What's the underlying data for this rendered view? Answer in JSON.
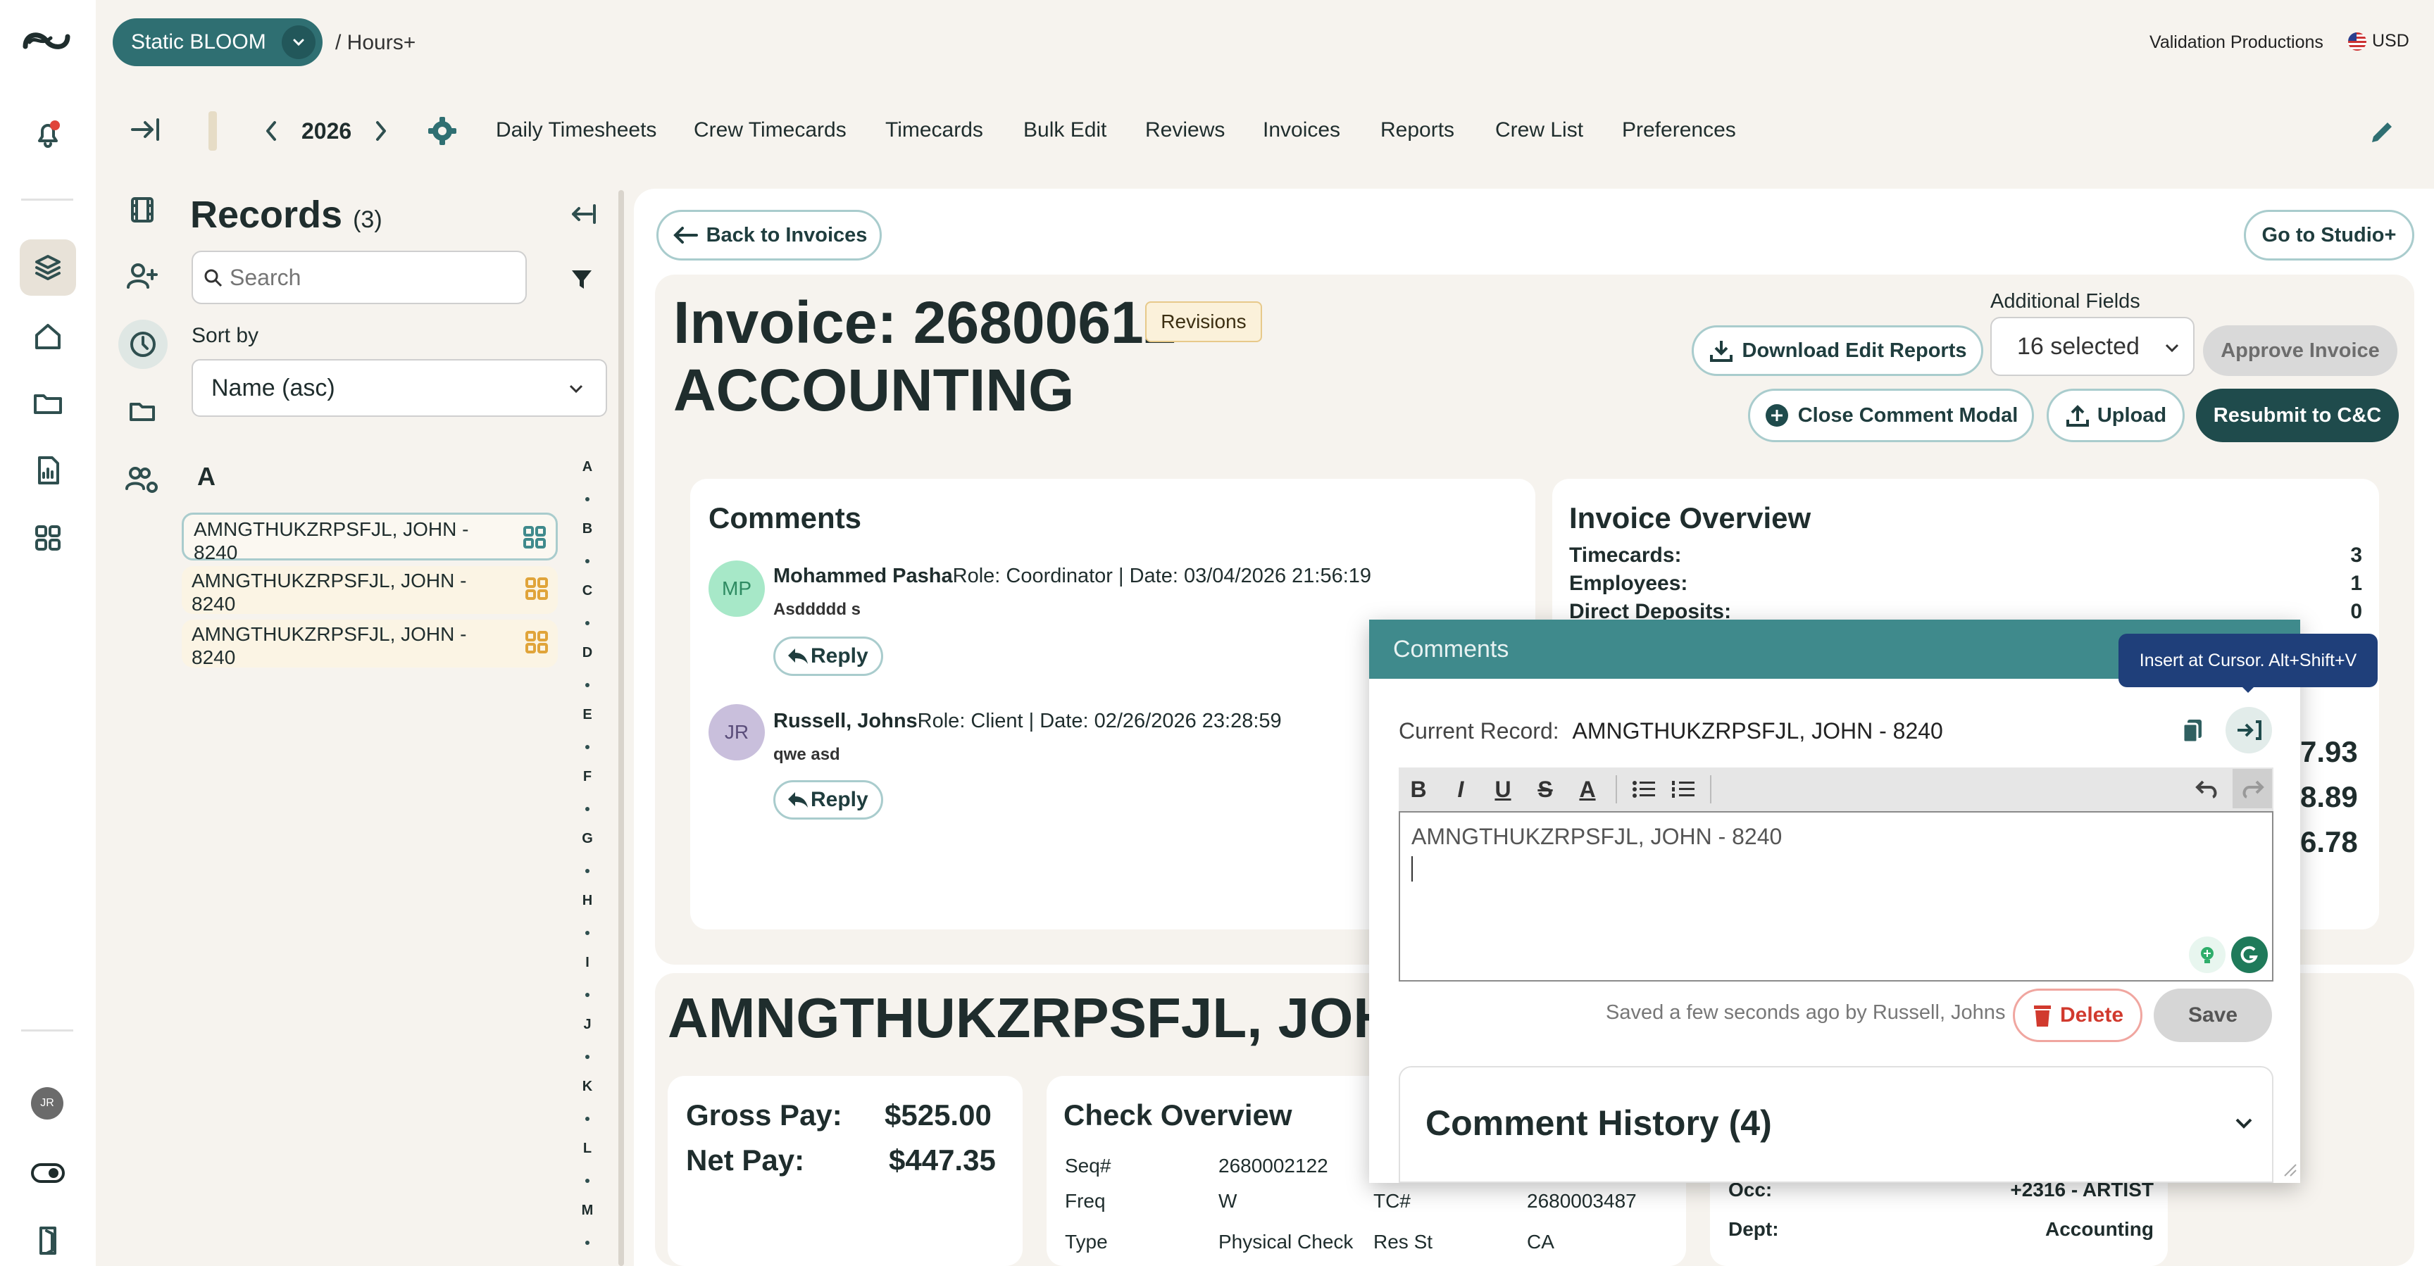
{
  "header": {
    "app_switcher": "Static BLOOM",
    "breadcrumb": "/ Hours+",
    "company": "Validation Productions",
    "currency": "USD"
  },
  "nav": {
    "year": "2026",
    "items": [
      "Daily Timesheets",
      "Crew Timecards",
      "Timecards",
      "Bulk Edit",
      "Reviews",
      "Invoices",
      "Reports",
      "Crew List",
      "Preferences"
    ]
  },
  "rail": {
    "user_initials": "JR"
  },
  "records": {
    "title": "Records",
    "count": "(3)",
    "search_placeholder": "Search",
    "sort_label": "Sort by",
    "sort_value": "Name (asc)",
    "group_letter": "A",
    "items": [
      {
        "line1": "AMNGTHUKZRPSFJL, JOHN -",
        "line2": "8240"
      },
      {
        "line1": "AMNGTHUKZRPSFJL, JOHN -",
        "line2": "8240"
      },
      {
        "line1": "AMNGTHUKZRPSFJL, JOHN -",
        "line2": "8240"
      }
    ],
    "alphabet": [
      "A",
      "B",
      "C",
      "D",
      "E",
      "F",
      "G",
      "H",
      "I",
      "J",
      "K",
      "L",
      "M"
    ]
  },
  "invoice": {
    "back_label": "Back to Invoices",
    "studio_label": "Go to Studio+",
    "title_line1": "Invoice: 26800612",
    "title_line2": "ACCOUNTING",
    "revisions_badge": "Revisions",
    "additional_fields_label": "Additional Fields",
    "additional_fields_value": "16 selected",
    "download_label": "Download Edit Reports",
    "approve_label": "Approve Invoice",
    "close_comment_label": "Close Comment Modal",
    "upload_label": "Upload",
    "resubmit_label": "Resubmit to C&C"
  },
  "comments": {
    "title": "Comments",
    "items": [
      {
        "initials": "MP",
        "name": "Mohammed Pasha",
        "meta": "Role: Coordinator | Date: 03/04/2026 21:56:19",
        "body": "Asddddd s",
        "reply": "Reply",
        "color": "#a7e8c8",
        "text_color": "#2e8b62"
      },
      {
        "initials": "JR",
        "name": "Russell, Johns",
        "meta": "Role: Client | Date: 02/26/2026 23:28:59",
        "body": "qwe asd",
        "reply": "Reply",
        "color": "#c9bfdc",
        "text_color": "#5a4d7a"
      }
    ]
  },
  "overview": {
    "title": "Invoice Overview",
    "rows": [
      {
        "label": "Timecards:",
        "value": "3"
      },
      {
        "label": "Employees:",
        "value": "1"
      },
      {
        "label": "Direct Deposits:",
        "value": "0"
      }
    ],
    "partial_amounts": [
      "7.93",
      "8.89",
      "6.78"
    ]
  },
  "record": {
    "name": "AMNGTHUKZRPSFJL, JOHN –",
    "gross_label": "Gross Pay:",
    "gross_value": "$525.00",
    "net_label": "Net Pay:",
    "net_value": "$447.35",
    "check_title": "Check Overview",
    "check_rows": [
      {
        "label": "Seq#",
        "value": "2680002122"
      },
      {
        "label": "Freq",
        "value": "W"
      },
      {
        "label": "Type",
        "value": "Physical Check"
      }
    ],
    "check_rows_right": [
      {
        "label": "TC#",
        "value": "2680003487"
      },
      {
        "label": "Res St",
        "value": "CA"
      }
    ],
    "occ_label": "Occ:",
    "occ_value": "+2316 - ARTIST",
    "dept_label": "Dept:",
    "dept_value": "Accounting"
  },
  "modal": {
    "title": "Comments",
    "tooltip": "Insert at Cursor. Alt+Shift+V",
    "current_record_label": "Current Record:",
    "current_record_value": "AMNGTHUKZRPSFJL, JOHN - 8240",
    "editor_text": "AMNGTHUKZRPSFJL, JOHN - 8240",
    "saved_text": "Saved a few seconds ago by Russell, Johns",
    "delete_label": "Delete",
    "save_label": "Save",
    "history_label": "Comment History (4)"
  }
}
